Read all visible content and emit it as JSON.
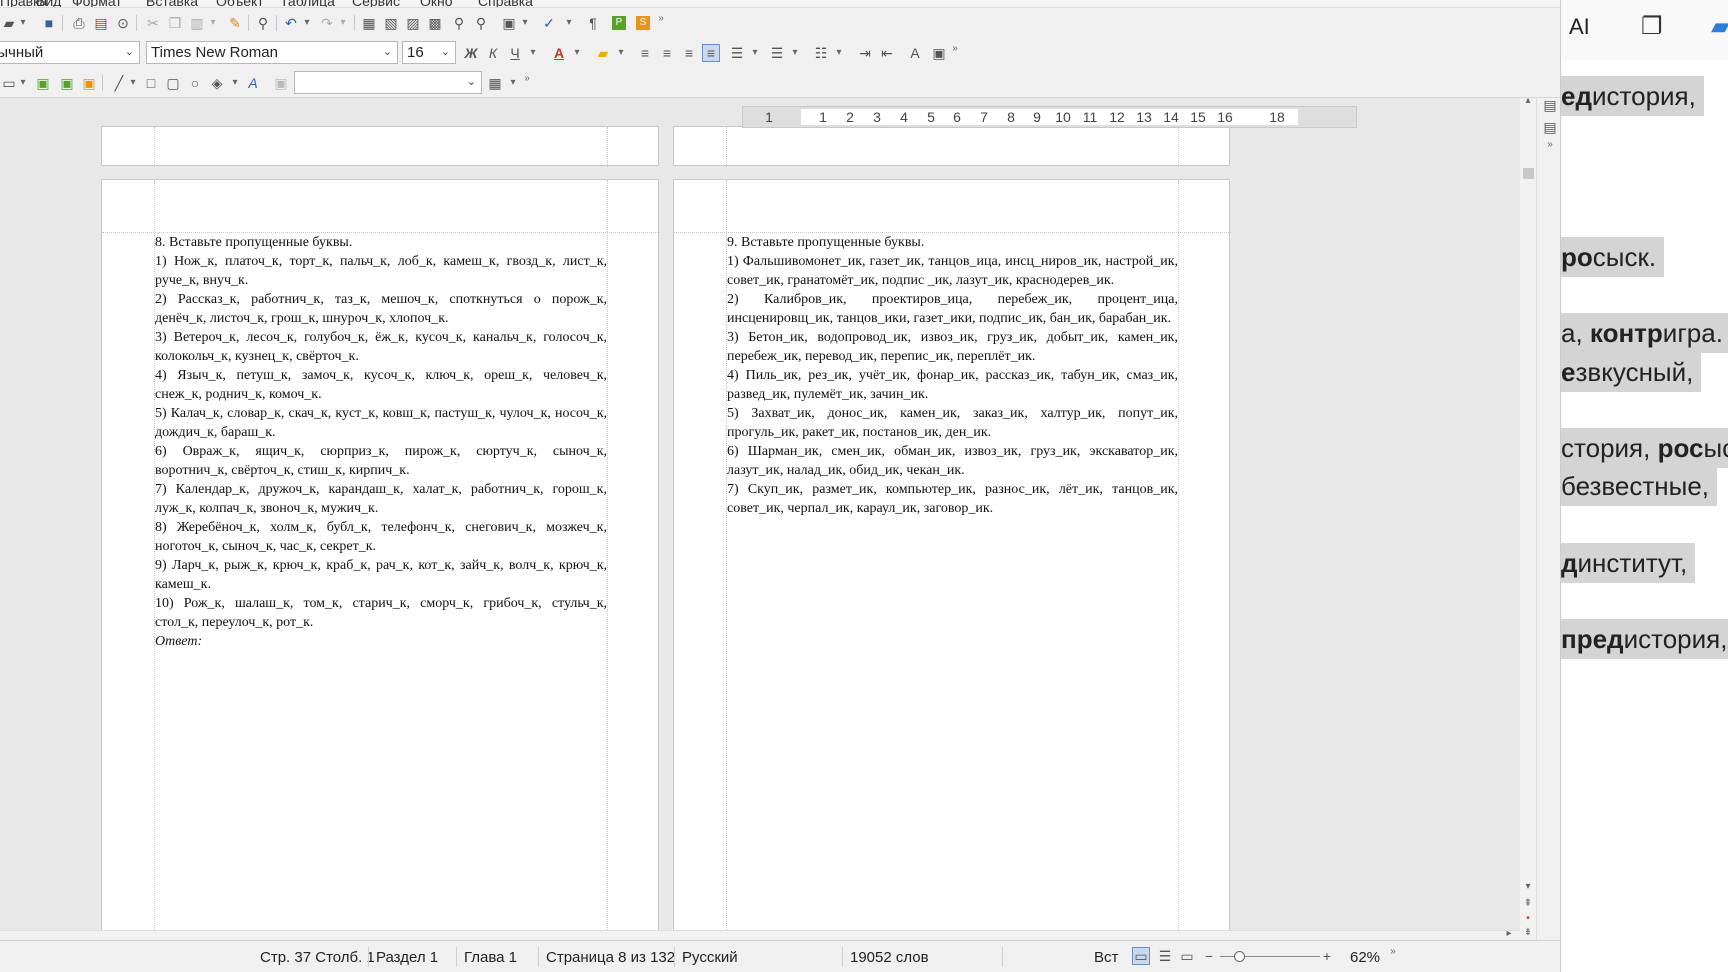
{
  "menubar": {
    "items": [
      "Правка",
      "Вид",
      "Формат",
      "Вставка",
      "Объект",
      "Таблица",
      "Сервис",
      "Окно",
      "Справка"
    ]
  },
  "toolbar2": {
    "style_value": "Обычный",
    "font_value": "Times New Roman",
    "size_value": "16",
    "bold_glyph": "Ж",
    "italic_glyph": "К",
    "underline_glyph": "Ч"
  },
  "ruler": {
    "labels": [
      "1",
      "1",
      "2",
      "3",
      "4",
      "5",
      "6",
      "7",
      "8",
      "9",
      "10",
      "11",
      "12",
      "13",
      "14",
      "15",
      "16",
      "18"
    ]
  },
  "page_left": {
    "lines": [
      "8. Вставьте пропущенные буквы.",
      "1) Нож_к, платоч_к, торт_к, пальч_к, лоб_к, камеш_к, гвозд_к, лист_к, руче_к, внуч_к.",
      "2) Рассказ_к, работнич_к, таз_к, мешоч_к, споткнуться о порож_к, денёч_к, листоч_к, грош_к, шнуроч_к, хлопоч_к.",
      "3) Ветероч_к, лесоч_к, голубоч_к, ёж_к, кусоч_к, канальч_к, голосоч_к, колокольч_к, кузнец_к, свёрточ_к.",
      "4) Языч_к, петуш_к, замоч_к, кусоч_к, ключ_к, ореш_к, человеч_к, снеж_к, роднич_к, комоч_к.",
      "5) Калач_к, словар_к, скач_к, куст_к, ковш_к, пастуш_к, чулоч_к, носоч_к, дождич_к, бараш_к.",
      "6) Овраж_к, ящич_к, сюрприз_к, пирож_к, сюртуч_к, сыноч_к, воротнич_к, свёрточ_к, стиш_к, кирпич_к.",
      "7) Календар_к, дружоч_к, карандаш_к, халат_к, работнич_к, горош_к, луж_к, колпач_к, звоноч_к, мужич_к.",
      "8) Жеребёноч_к, холм_к, бубл_к, телефонч_к, снегович_к, мозжеч_к, ноготоч_к, сыноч_к, час_к, секрет_к.",
      "9) Ларч_к, рыж_к, крюч_к, краб_к, рач_к, кот_к, зайч_к, волч_к, крюч_к, камеш_к.",
      "10) Рож_к, шалаш_к, том_к, старич_к, сморч_к, грибоч_к, стульч_к, стол_к, переулоч_к, рот_к."
    ],
    "answer_label": "Ответ:"
  },
  "page_right": {
    "lines": [
      "9. Вставьте пропущенные буквы.",
      "1) Фальшивомонет_ик, газет_ик, танцов_ица, инсц_ниров_ик, настрой_ик, совет_ик, гранатомёт_ик, подпис _ик, лазут_ик, краснодерев_ик.",
      "2) Калибров_ик, проектиров_ица, перебеж_ик, процент_ица, инсценировщ_ик, танцов_ики, газет_ики, подпис_ик, бан_ик, барабан_ик.",
      "3) Бетон_ик, водопровод_ик, извоз_ик, груз_ик, добыт_ик, камен_ик, перебеж_ик, перевод_ик, перепис_ик, переплёт_ик.",
      "4) Пиль_ик, рез_ик, учёт_ик, фонар_ик, рассказ_ик, табун_ик, смаз_ик, развед_ик, пулемёт_ик, зачин_ик.",
      "5) Захват_ик, донос_ик, камен_ик, заказ_ик, халтур_ик, попут_ик, прогуль_ик, ракет_ик, постанов_ик, ден_ик.",
      "6) Шарман_ик, смен_ик, обман_ик, извоз_ик, груз_ик, экскаватор_ик, лазут_ик, налад_ик, обид_ик, чекан_ик.",
      "7) Скуп_ик, размет_ик, компьютер_ик, разнос_ик, лёт_ик, танцов_ик, совет_ик, черпал_ик, караул_ик, заговор_ик."
    ]
  },
  "statusbar": {
    "position": "Стр. 37 Столб. 1",
    "section": "Раздел 1",
    "chapter": "Глава 1",
    "page": "Страница 8 из 132",
    "language": "Русский",
    "words": "19052 слов",
    "insert_mode": "Вст",
    "zoom": "62%"
  },
  "right_panel": {
    "ai_label": "AI",
    "lines": [
      {
        "bold": "ед",
        "rest": "история,"
      },
      {
        "bold": "ро",
        "rest": "сыск."
      },
      {
        "bold": "",
        "pre": "а, ",
        "bold2": "контр",
        "rest": "игра."
      },
      {
        "bold": "е",
        "rest": "звкусный,"
      },
      {
        "bold": "",
        "pre": "стория, ",
        "bold2": "рос",
        "rest": "ыс"
      },
      {
        "bold": "",
        "rest": " безвестные,"
      },
      {
        "bold": "д",
        "rest": "институт,"
      },
      {
        "bold": "пред",
        "rest": "история,"
      }
    ]
  }
}
